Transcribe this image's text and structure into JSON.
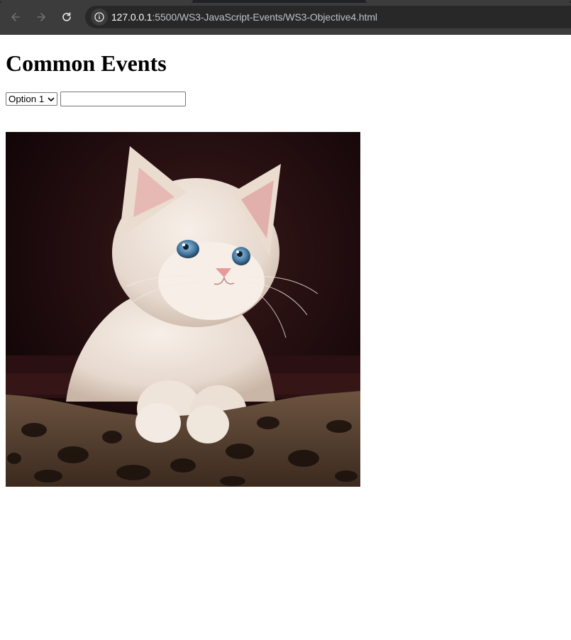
{
  "browser": {
    "url_host": "127.0.0.1",
    "url_rest": ":5500/WS3-JavaScript-Events/WS3-Objective4.html",
    "back_icon": "arrow-left-icon",
    "forward_icon": "arrow-right-icon",
    "reload_icon": "reload-icon",
    "site_info_icon": "info-icon"
  },
  "page": {
    "title": "Common Events",
    "select": {
      "selected": "Option 1"
    },
    "text_input": {
      "value": ""
    },
    "image": {
      "subject": "kitten",
      "icon": "cat-photo"
    }
  },
  "colors": {
    "chrome_bg": "#3c3c3c",
    "omnibox_bg": "#282828",
    "page_bg": "#ffffff"
  }
}
